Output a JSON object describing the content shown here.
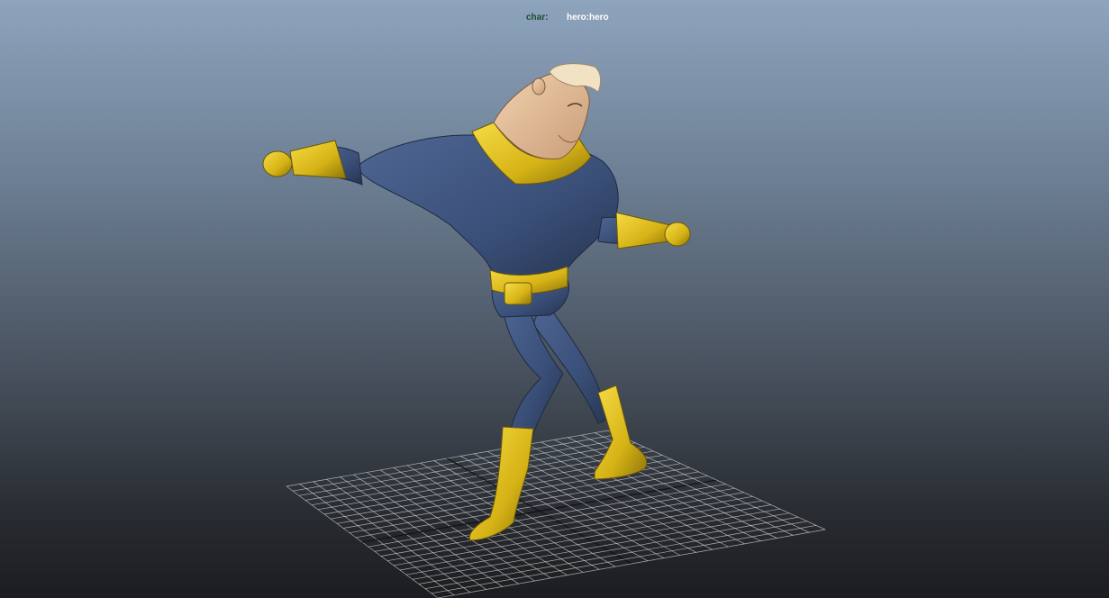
{
  "hud": {
    "label": "char:",
    "value": "hero:hero"
  },
  "footer": {
    "text": ""
  },
  "icons": {
    "character": "superhero-character-icon",
    "grid": "ground-grid-icon"
  },
  "colors": {
    "background_top": "#8ea4bd",
    "background_bottom": "#1c1d20",
    "suit": "#3a4f78",
    "accent": "#e3c21d",
    "skin": "#e8c4a0",
    "hair": "#f0e2c2",
    "grid": "#d8d8d8",
    "hud_label": "#1c4d2c",
    "hud_value": "#ffffff"
  }
}
